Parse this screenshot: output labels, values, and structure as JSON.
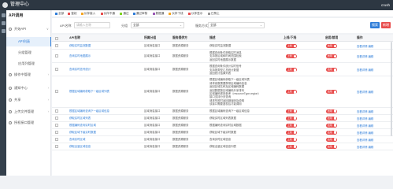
{
  "app": {
    "title": "管理中心",
    "user": "crush"
  },
  "sidebar": {
    "title": "API调用",
    "items": [
      {
        "label": "开始API",
        "sub": false,
        "active": false,
        "arrow": "∨"
      },
      {
        "label": "API列表",
        "sub": true,
        "active": true
      },
      {
        "label": "分组管理",
        "sub": true,
        "active": false
      },
      {
        "label": "应用列管理",
        "sub": true,
        "active": false
      },
      {
        "label": "操作中管理",
        "sub": false,
        "active": false,
        "arrow": "›"
      },
      {
        "label": "通知中心",
        "sub": false,
        "active": false,
        "arrow": "›"
      },
      {
        "label": "共享",
        "sub": false,
        "active": false,
        "arrow": "›"
      },
      {
        "label": "上传文件管理",
        "sub": false,
        "active": false,
        "arrow": "›"
      },
      {
        "label": "授权接口管理",
        "sub": false,
        "active": false
      }
    ]
  },
  "legend": [
    {
      "label": "全部",
      "color": "#2f7dd8"
    },
    {
      "label": "鉴权",
      "color": "#e84d4d"
    },
    {
      "label": "伙伴接入",
      "color": "#f5a623"
    },
    {
      "label": "伙伴不通",
      "color": "#e84d4d"
    },
    {
      "label": "通过",
      "color": "#7ed321"
    },
    {
      "label": "通过审核",
      "color": "#2f7dd8"
    },
    {
      "label": "数据通",
      "color": "#9b59b6"
    },
    {
      "label": "伙伴下线",
      "color": "#f5a623"
    },
    {
      "label": "伙伴显示",
      "color": "#e84d4d"
    },
    {
      "label": "已禁止",
      "color": "#999999"
    }
  ],
  "filter": {
    "name_label": "API名称",
    "name_placeholder": "请输入名称",
    "group_label": "分组",
    "group_value": "全部",
    "type_label": "服务方式",
    "type_value": "全部",
    "search_label": "搜索",
    "add_label": "新增"
  },
  "table": {
    "headers": [
      "API名称",
      "所属分组",
      "服务提供方",
      "描述",
      "上线/下线",
      "启用/禁用",
      "操作"
    ],
    "rows": [
      {
        "name": "获取实时监测数据",
        "group": "区域消息接口",
        "provider": "数据资源服务",
        "desc": [
          "获取实时监测数据"
        ],
        "online": "上线",
        "enable": "启用",
        "ops": "查看详情 编辑"
      },
      {
        "name": "查询实时地图展示",
        "group": "区域消息接口",
        "provider": "数据资源服务",
        "desc": [
          "根据查询条件获取实时消息",
          "支持按区域和时间范围检索",
          "返回实时地图展示数据"
        ],
        "online": "上线",
        "enable": "启用",
        "ops": "查看详情 编辑"
      },
      {
        "name": "查询实时信号统计",
        "group": "区域消息接口",
        "provider": "数据资源服务",
        "desc": [
          "根据查询条件统计实时信号",
          "支持按类型汇总统计数据",
          "返回统计结果列表"
        ],
        "online": "上线",
        "enable": "启用",
        "ops": "查看详情 编辑"
      },
      {
        "name": "根据区域编码获取下一级区域列表",
        "group": "区域消息接口",
        "provider": "数据资源服务",
        "desc": [
          "根据区域编码获取下一级区域列表",
          "请求参数需要携带区域编码信息",
          "返回区域名称及区域编码数据",
          "返回数据按区域编码升序排列",
          "区域编码规则参考（resourceType,region）",
          "接口支持分页查询",
          "请求失败时返回错误码及说明",
          "该接口需要鉴权后才能调用"
        ],
        "online": "上线",
        "enable": "启用",
        "ops": "查看详情 编辑"
      },
      {
        "name": "根据区域编码查询下一级区域信息",
        "group": "区域消息接口",
        "provider": "数据资源服务",
        "desc": [
          "根据区域编码查询下一级区域信息"
        ],
        "online": "上线",
        "enable": "启用",
        "ops": "查看详情 编辑"
      },
      {
        "name": "获取实时区域列表",
        "group": "区域消息接口",
        "provider": "数据资源服务",
        "desc": [
          "获取实时区域列表数据"
        ],
        "online": "上线",
        "enable": "启用",
        "ops": "查看详情 编辑"
      },
      {
        "name": "根据编码查询实时区域",
        "group": "区域消息接口",
        "provider": "数据资源服务",
        "desc": [
          "根据编码查询实时区域数据"
        ],
        "online": "上线",
        "enable": "启用",
        "ops": "查看详情 编辑"
      },
      {
        "name": "获取区域下级实时数据",
        "group": "区域消息接口",
        "provider": "数据资源服务",
        "desc": [
          "获取区域下级实时数据"
        ],
        "online": "上线",
        "enable": "启用",
        "ops": "查看详情 编辑"
      },
      {
        "name": "查询实时区域",
        "group": "区域消息接口",
        "provider": "数据资源服务",
        "desc": [
          "查询实时区域信息"
        ],
        "online": "上线",
        "enable": "启用",
        "ops": "查看详情 编辑"
      },
      {
        "name": "获取全量区域信息",
        "group": "区域消息接口",
        "provider": "数据资源服务",
        "desc": [
          "获取全量区域信息列表"
        ],
        "online": "上线",
        "enable": "启用",
        "ops": "查看详情 编辑"
      }
    ]
  }
}
